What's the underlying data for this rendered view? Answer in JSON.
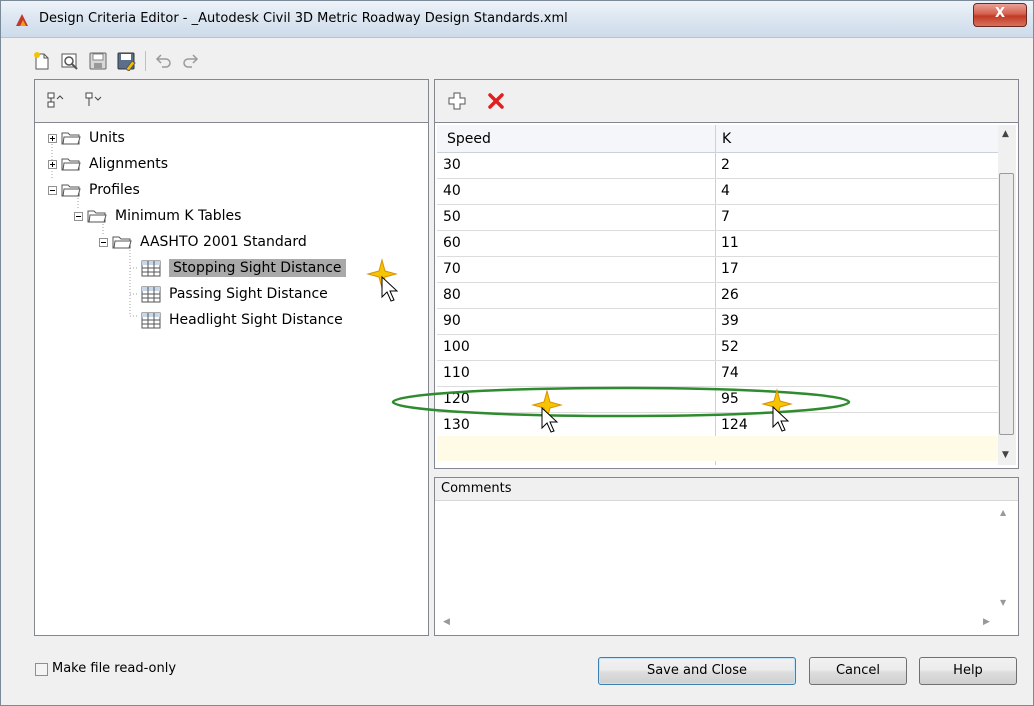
{
  "window": {
    "title": "Design Criteria Editor - _Autodesk Civil 3D Metric Roadway Design Standards.xml",
    "close_label": "X"
  },
  "toolbar": {
    "icons": [
      "new-file-icon",
      "open-file-icon",
      "save-icon",
      "save-as-icon",
      "undo-icon",
      "redo-icon"
    ]
  },
  "tree": {
    "nodes": [
      {
        "label": "Units",
        "expander": "plus"
      },
      {
        "label": "Alignments",
        "expander": "plus"
      },
      {
        "label": "Profiles",
        "expander": "minus"
      },
      {
        "label": "Minimum K Tables",
        "expander": "minus"
      },
      {
        "label": "AASHTO 2001 Standard",
        "expander": "minus"
      },
      {
        "label": "Stopping Sight Distance",
        "selected": true
      },
      {
        "label": "Passing Sight Distance"
      },
      {
        "label": "Headlight Sight Distance"
      }
    ]
  },
  "grid": {
    "columns": [
      "Speed",
      "K"
    ],
    "rows": [
      [
        "30",
        "2"
      ],
      [
        "40",
        "4"
      ],
      [
        "50",
        "7"
      ],
      [
        "60",
        "11"
      ],
      [
        "70",
        "17"
      ],
      [
        "80",
        "26"
      ],
      [
        "90",
        "39"
      ],
      [
        "100",
        "52"
      ],
      [
        "110",
        "74"
      ],
      [
        "120",
        "95"
      ],
      [
        "130",
        "124"
      ]
    ]
  },
  "comments": {
    "label": "Comments",
    "value": ""
  },
  "footer": {
    "readonly_label": "Make file read-only",
    "readonly_checked": false,
    "save_close_label": "Save and Close",
    "cancel_label": "Cancel",
    "help_label": "Help"
  },
  "colors": {
    "highlight_ellipse": "#2e8b2e",
    "selection": "#a9a9a9",
    "new_row": "#fffbe7",
    "delete_x": "#e02020"
  }
}
